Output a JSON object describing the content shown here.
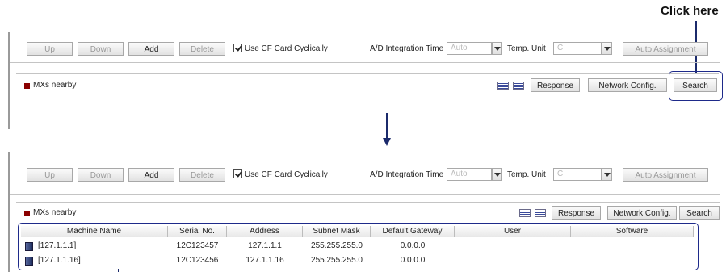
{
  "callout": {
    "text": "Click here"
  },
  "toolbar": {
    "up": "Up",
    "down": "Down",
    "add": "Add",
    "delete": "Delete",
    "use_cf": "Use CF Card Cyclically",
    "ad_label": "A/D Integration Time",
    "ad_value": "Auto",
    "temp_label": "Temp. Unit",
    "temp_value": "C",
    "auto_assign": "Auto Assignment"
  },
  "nearby": {
    "title": "MXs nearby",
    "response": "Response",
    "network_config": "Network Config.",
    "search": "Search"
  },
  "table": {
    "headers": [
      "Machine Name",
      "Serial No.",
      "Address",
      "Subnet Mask",
      "Default Gateway",
      "User",
      "Software"
    ],
    "rows": [
      {
        "name": "[127.1.1.1]",
        "serial": "12C123457",
        "address": "127.1.1.1",
        "subnet": "255.255.255.0",
        "gateway": "0.0.0.0",
        "user": "",
        "software": ""
      },
      {
        "name": "[127.1.1.16]",
        "serial": "12C123456",
        "address": "127.1.1.16",
        "subnet": "255.255.255.0",
        "gateway": "0.0.0.0",
        "user": "",
        "software": ""
      }
    ]
  },
  "colors": {
    "highlight": "#1e2a8a",
    "status_square": "#8b0000"
  }
}
